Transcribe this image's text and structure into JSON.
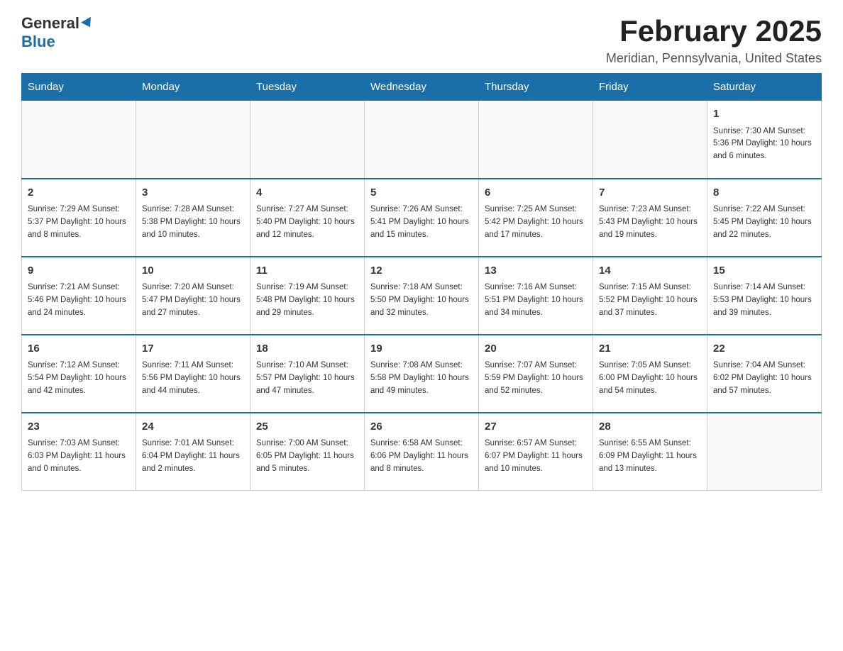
{
  "header": {
    "logo_general": "General",
    "logo_blue": "Blue",
    "title": "February 2025",
    "subtitle": "Meridian, Pennsylvania, United States"
  },
  "days_of_week": [
    "Sunday",
    "Monday",
    "Tuesday",
    "Wednesday",
    "Thursday",
    "Friday",
    "Saturday"
  ],
  "weeks": [
    [
      {
        "day": "",
        "info": ""
      },
      {
        "day": "",
        "info": ""
      },
      {
        "day": "",
        "info": ""
      },
      {
        "day": "",
        "info": ""
      },
      {
        "day": "",
        "info": ""
      },
      {
        "day": "",
        "info": ""
      },
      {
        "day": "1",
        "info": "Sunrise: 7:30 AM\nSunset: 5:36 PM\nDaylight: 10 hours and 6 minutes."
      }
    ],
    [
      {
        "day": "2",
        "info": "Sunrise: 7:29 AM\nSunset: 5:37 PM\nDaylight: 10 hours and 8 minutes."
      },
      {
        "day": "3",
        "info": "Sunrise: 7:28 AM\nSunset: 5:38 PM\nDaylight: 10 hours and 10 minutes."
      },
      {
        "day": "4",
        "info": "Sunrise: 7:27 AM\nSunset: 5:40 PM\nDaylight: 10 hours and 12 minutes."
      },
      {
        "day": "5",
        "info": "Sunrise: 7:26 AM\nSunset: 5:41 PM\nDaylight: 10 hours and 15 minutes."
      },
      {
        "day": "6",
        "info": "Sunrise: 7:25 AM\nSunset: 5:42 PM\nDaylight: 10 hours and 17 minutes."
      },
      {
        "day": "7",
        "info": "Sunrise: 7:23 AM\nSunset: 5:43 PM\nDaylight: 10 hours and 19 minutes."
      },
      {
        "day": "8",
        "info": "Sunrise: 7:22 AM\nSunset: 5:45 PM\nDaylight: 10 hours and 22 minutes."
      }
    ],
    [
      {
        "day": "9",
        "info": "Sunrise: 7:21 AM\nSunset: 5:46 PM\nDaylight: 10 hours and 24 minutes."
      },
      {
        "day": "10",
        "info": "Sunrise: 7:20 AM\nSunset: 5:47 PM\nDaylight: 10 hours and 27 minutes."
      },
      {
        "day": "11",
        "info": "Sunrise: 7:19 AM\nSunset: 5:48 PM\nDaylight: 10 hours and 29 minutes."
      },
      {
        "day": "12",
        "info": "Sunrise: 7:18 AM\nSunset: 5:50 PM\nDaylight: 10 hours and 32 minutes."
      },
      {
        "day": "13",
        "info": "Sunrise: 7:16 AM\nSunset: 5:51 PM\nDaylight: 10 hours and 34 minutes."
      },
      {
        "day": "14",
        "info": "Sunrise: 7:15 AM\nSunset: 5:52 PM\nDaylight: 10 hours and 37 minutes."
      },
      {
        "day": "15",
        "info": "Sunrise: 7:14 AM\nSunset: 5:53 PM\nDaylight: 10 hours and 39 minutes."
      }
    ],
    [
      {
        "day": "16",
        "info": "Sunrise: 7:12 AM\nSunset: 5:54 PM\nDaylight: 10 hours and 42 minutes."
      },
      {
        "day": "17",
        "info": "Sunrise: 7:11 AM\nSunset: 5:56 PM\nDaylight: 10 hours and 44 minutes."
      },
      {
        "day": "18",
        "info": "Sunrise: 7:10 AM\nSunset: 5:57 PM\nDaylight: 10 hours and 47 minutes."
      },
      {
        "day": "19",
        "info": "Sunrise: 7:08 AM\nSunset: 5:58 PM\nDaylight: 10 hours and 49 minutes."
      },
      {
        "day": "20",
        "info": "Sunrise: 7:07 AM\nSunset: 5:59 PM\nDaylight: 10 hours and 52 minutes."
      },
      {
        "day": "21",
        "info": "Sunrise: 7:05 AM\nSunset: 6:00 PM\nDaylight: 10 hours and 54 minutes."
      },
      {
        "day": "22",
        "info": "Sunrise: 7:04 AM\nSunset: 6:02 PM\nDaylight: 10 hours and 57 minutes."
      }
    ],
    [
      {
        "day": "23",
        "info": "Sunrise: 7:03 AM\nSunset: 6:03 PM\nDaylight: 11 hours and 0 minutes."
      },
      {
        "day": "24",
        "info": "Sunrise: 7:01 AM\nSunset: 6:04 PM\nDaylight: 11 hours and 2 minutes."
      },
      {
        "day": "25",
        "info": "Sunrise: 7:00 AM\nSunset: 6:05 PM\nDaylight: 11 hours and 5 minutes."
      },
      {
        "day": "26",
        "info": "Sunrise: 6:58 AM\nSunset: 6:06 PM\nDaylight: 11 hours and 8 minutes."
      },
      {
        "day": "27",
        "info": "Sunrise: 6:57 AM\nSunset: 6:07 PM\nDaylight: 11 hours and 10 minutes."
      },
      {
        "day": "28",
        "info": "Sunrise: 6:55 AM\nSunset: 6:09 PM\nDaylight: 11 hours and 13 minutes."
      },
      {
        "day": "",
        "info": ""
      }
    ]
  ]
}
